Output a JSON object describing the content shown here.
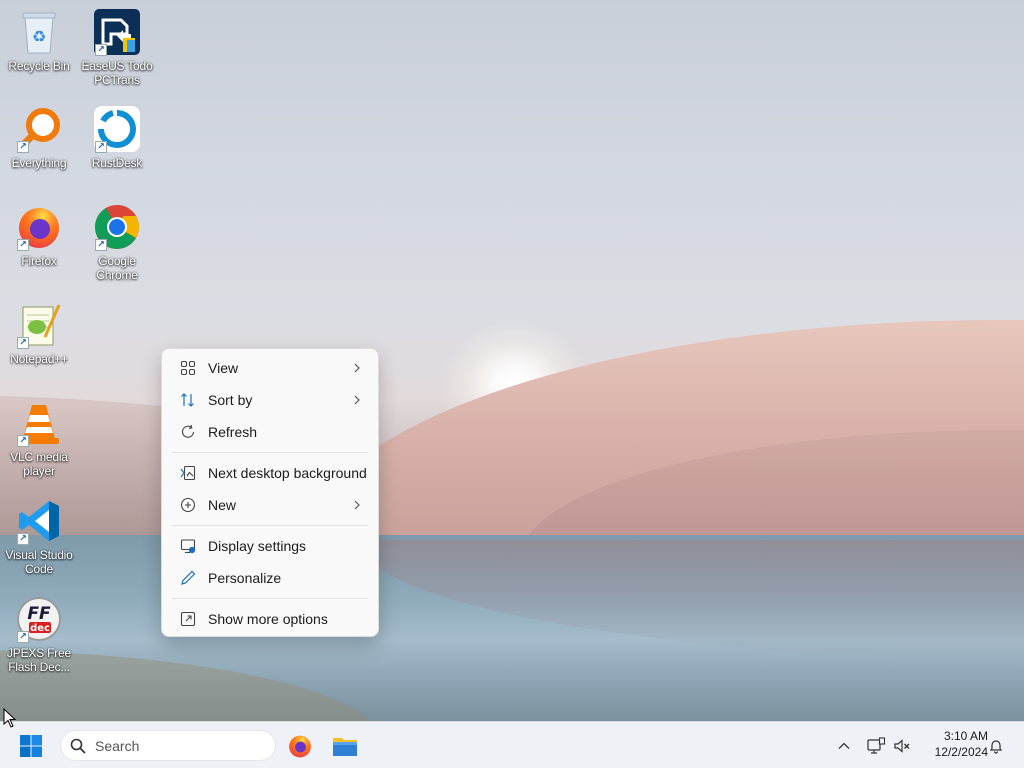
{
  "desktop": {
    "icons": [
      {
        "label": "Recycle Bin",
        "icon": "recycle-bin-icon"
      },
      {
        "label": "EaseUS Todo PCTrans",
        "icon": "easeus-pctrans-icon"
      },
      {
        "label": "Everything",
        "icon": "everything-search-icon"
      },
      {
        "label": "RustDesk",
        "icon": "rustdesk-icon"
      },
      {
        "label": "Firefox",
        "icon": "firefox-icon"
      },
      {
        "label": "Google Chrome",
        "icon": "chrome-icon"
      },
      {
        "label": "Notepad++",
        "icon": "notepad-plus-plus-icon"
      },
      {
        "label": "VLC media player",
        "icon": "vlc-icon"
      },
      {
        "label": "Visual Studio Code",
        "icon": "vscode-icon"
      },
      {
        "label": "JPEXS Free Flash Dec...",
        "icon": "jpexs-ffdec-icon"
      }
    ]
  },
  "context_menu": {
    "items": [
      {
        "label": "View",
        "icon": "grid-view-icon",
        "submenu": true
      },
      {
        "label": "Sort by",
        "icon": "sort-arrows-icon",
        "submenu": true
      },
      {
        "label": "Refresh",
        "icon": "refresh-icon",
        "submenu": false
      },
      {
        "label": "Next desktop background",
        "icon": "next-background-icon",
        "submenu": false
      },
      {
        "label": "New",
        "icon": "plus-circle-icon",
        "submenu": true
      },
      {
        "label": "Display settings",
        "icon": "display-settings-icon",
        "submenu": false
      },
      {
        "label": "Personalize",
        "icon": "pen-icon",
        "submenu": false
      },
      {
        "label": "Show more options",
        "icon": "external-options-icon",
        "submenu": false
      }
    ]
  },
  "taskbar": {
    "search_placeholder": "Search",
    "pinned_apps": [
      "firefox-icon",
      "file-explorer-icon"
    ],
    "tray_icons": [
      "chevron-up-icon",
      "network-icon",
      "volume-muted-icon",
      "notification-bell-icon"
    ],
    "clock_time": "3:10 AM",
    "clock_date": "12/2/2024"
  },
  "colors": {
    "accent": "#0067c0",
    "menu_background": "#f9f9f9",
    "taskbar_background": "#eef1f6"
  }
}
